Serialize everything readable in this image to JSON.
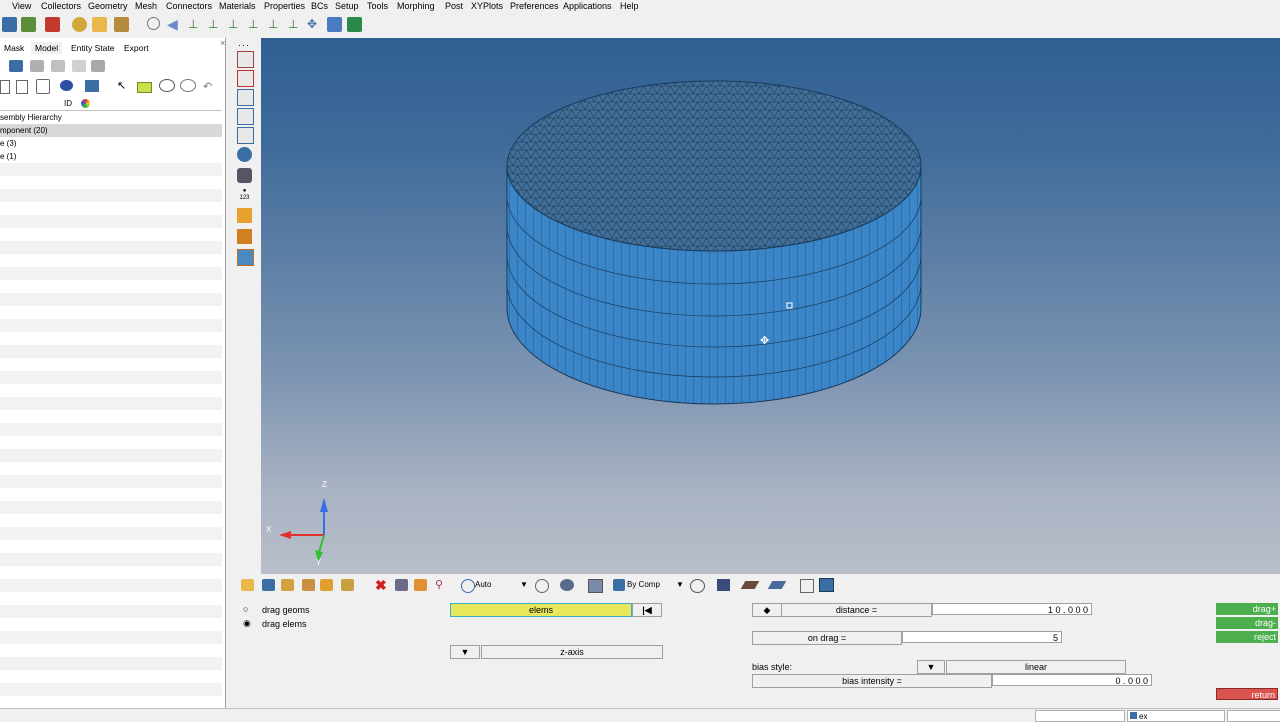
{
  "menu": [
    "View",
    "Collectors",
    "Geometry",
    "Mesh",
    "Connectors",
    "Materials",
    "Properties",
    "BCs",
    "Setup",
    "Tools",
    "Morphing",
    "Post",
    "XYPlots",
    "Preferences",
    "Applications",
    "Help"
  ],
  "tabs": [
    "Mask",
    "Model",
    "Entity State",
    "Export"
  ],
  "list_header": {
    "id": "ID"
  },
  "tree": [
    "sembly Hierarchy",
    "mponent (20)",
    "e (3)",
    "e (1)"
  ],
  "bottom_toolbar": {
    "auto": "Auto",
    "by_comp": "By Comp"
  },
  "panel": {
    "radio1": "drag geoms",
    "radio2": "drag elems",
    "elems": "elems",
    "z_axis": "z-axis",
    "distance_label": "distance =",
    "distance_value": "1 0 . 0 0 0",
    "on_drag_label": "on drag =",
    "on_drag_value": "5",
    "bias_style_label": "bias style:",
    "bias_style_value": "linear",
    "bias_intensity_label": "bias intensity =",
    "bias_intensity_value": "0 . 0 0 0",
    "drag_plus": "drag+",
    "drag_minus": "drag-",
    "reject": "reject",
    "return": "return"
  },
  "triad": {
    "x": "X",
    "y": "Y",
    "z": "Z"
  },
  "status": {
    "ex": "ex"
  },
  "colors": {
    "viewport_top": "#2f5f93",
    "mesh_side": "#3a86c8",
    "accent_green": "#4cae4c",
    "return_red": "#d9534f",
    "elems_field": "#e6e85a"
  }
}
